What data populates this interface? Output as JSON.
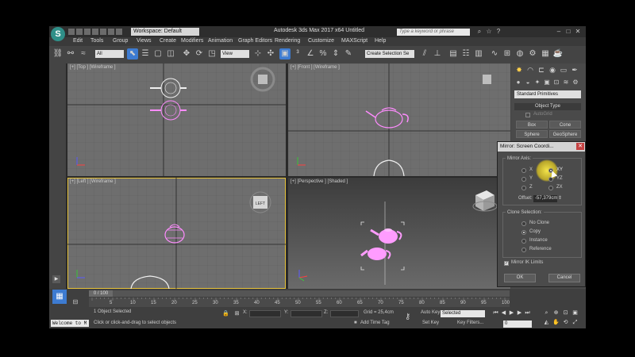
{
  "titlebar": {
    "logo_text": "S",
    "workspace": "Workspace: Default",
    "app_title": "Autodesk 3ds Max 2017 x64    Untitled",
    "search_placeholder": "Type a keyword or phrase"
  },
  "menus": [
    "Edit",
    "Tools",
    "Group",
    "Views",
    "Create",
    "Modifiers",
    "Animation",
    "Graph Editors",
    "Rendering",
    "Customize",
    "MAXScript",
    "Help"
  ],
  "toolbar": {
    "filter_value": "All",
    "ref_coord_value": "View",
    "selection_set_placeholder": "Create Selection Se"
  },
  "viewports": {
    "top_label": "[+] [Top ] [Wireframe ]",
    "front_label": "[+] [Front ] [Wireframe ]",
    "left_label": "[+] [Left ] [Wireframe ]",
    "perspective_label": "[+] [Perspective ] [Shaded ]",
    "viewcube_left_text": "LEFT"
  },
  "command_panel": {
    "category": "Standard Primitives",
    "rollout_title": "Object Type",
    "autogrid": "AutoGrid",
    "buttons": [
      "Box",
      "Cone",
      "Sphere",
      "GeoSphere"
    ]
  },
  "dialog": {
    "title": "Mirror: Screen Coordi...",
    "mirror_axis_label": "Mirror Axis:",
    "axes": [
      "X",
      "Y",
      "Z",
      "XY",
      "YZ",
      "ZX"
    ],
    "selected_axis": "XY",
    "offset_label": "Offset:",
    "offset_value": "-57,379cm",
    "clone_label": "Clone Selection:",
    "clone_options": [
      "No Clone",
      "Copy",
      "Instance",
      "Reference"
    ],
    "selected_clone": "Copy",
    "ik_label": "Mirror IK Limits",
    "ok": "OK",
    "cancel": "Cancel"
  },
  "timeline": {
    "frame_label": "0 / 100",
    "ticks": [
      "5",
      "10",
      "15",
      "20",
      "25",
      "30",
      "35",
      "40",
      "45",
      "50",
      "55",
      "60",
      "65",
      "70",
      "75",
      "80",
      "85",
      "90",
      "95",
      "100"
    ]
  },
  "status": {
    "selected": "1 Object Selected",
    "prompt": "Click or click-and-drag to select objects",
    "maxscript": "Welcome to M",
    "x_label": "X:",
    "y_label": "Y:",
    "z_label": "Z:",
    "grid": "Grid = 25,4cm",
    "add_time_tag": "Add Time Tag",
    "auto_key": "Auto Key",
    "set_key": "Set Key",
    "selected_dropdown": "Selected",
    "key_filters": "Key Filters...",
    "frame_value": "0"
  },
  "colors": {
    "teapot": "#ff8cff",
    "teapot_white": "#f0f0f0",
    "grid": "#5a5a5a",
    "accent": "#2f8f88"
  }
}
